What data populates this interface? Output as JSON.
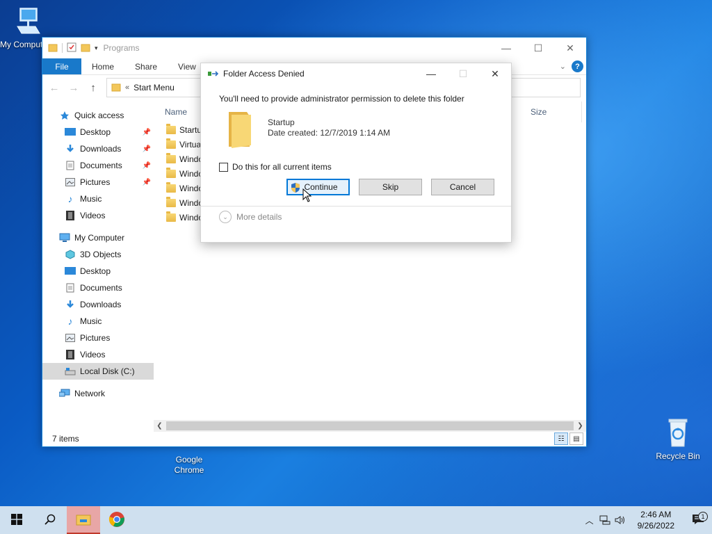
{
  "desktop": {
    "icons": [
      {
        "label": "My Computer"
      },
      {
        "label": "Google Chrome"
      },
      {
        "label": "Recycle Bin"
      }
    ]
  },
  "explorer": {
    "title": "Programs",
    "ribbon": {
      "file": "File",
      "tabs": [
        "Home",
        "Share",
        "View"
      ]
    },
    "address": {
      "prefix": "«",
      "path": "Start Menu"
    },
    "nav": {
      "quick_access": "Quick access",
      "quick_items": [
        "Desktop",
        "Downloads",
        "Documents",
        "Pictures",
        "Music",
        "Videos"
      ],
      "my_computer": "My Computer",
      "computer_items": [
        "3D Objects",
        "Desktop",
        "Documents",
        "Downloads",
        "Music",
        "Pictures",
        "Videos",
        "Local Disk (C:)"
      ],
      "network": "Network"
    },
    "columns": {
      "name": "Name",
      "size": "Size"
    },
    "files": [
      "Startup",
      "Virtua",
      "Windo",
      "Windo",
      "Windo",
      "Windo",
      "Windo"
    ],
    "status": "7 items"
  },
  "dialog": {
    "title": "Folder Access Denied",
    "message": "You'll need to provide administrator permission to delete this folder",
    "item_name": "Startup",
    "item_date": "Date created: 12/7/2019 1:14 AM",
    "checkbox_label": "Do this for all current items",
    "checkbox_checked": false,
    "buttons": {
      "continue": "Continue",
      "skip": "Skip",
      "cancel": "Cancel"
    },
    "more_details": "More details"
  },
  "taskbar": {
    "time": "2:46 AM",
    "date": "9/26/2022",
    "notification_count": "1"
  },
  "colors": {
    "accent": "#0078d7",
    "file_tab": "#1979ca",
    "folder": "#f3c75a"
  }
}
